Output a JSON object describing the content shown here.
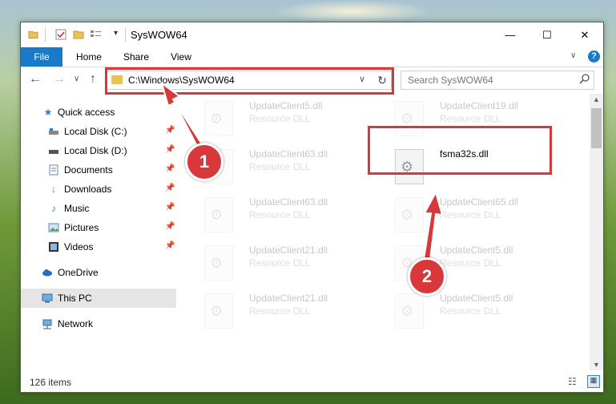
{
  "window": {
    "title": "SysWOW64",
    "controls": {
      "minimize": "—",
      "maximize": "☐",
      "close": "✕"
    }
  },
  "ribbon": {
    "tabs": [
      "File",
      "Home",
      "Share",
      "View"
    ],
    "help": "?"
  },
  "address": {
    "path": "C:\\Windows\\SysWOW64",
    "refresh": "↻",
    "search_placeholder": "Search SysWOW64"
  },
  "nav": {
    "items": [
      {
        "label": "Quick access",
        "icon": "star-icon"
      },
      {
        "label": "Local Disk (C:)",
        "icon": "drive-icon",
        "pinned": true
      },
      {
        "label": "Local Disk (D:)",
        "icon": "drive-icon",
        "pinned": true
      },
      {
        "label": "Documents",
        "icon": "documents-icon",
        "pinned": true
      },
      {
        "label": "Downloads",
        "icon": "download-icon",
        "pinned": true
      },
      {
        "label": "Music",
        "icon": "music-icon",
        "pinned": true
      },
      {
        "label": "Pictures",
        "icon": "pictures-icon",
        "pinned": true
      },
      {
        "label": "Videos",
        "icon": "videos-icon",
        "pinned": true
      },
      {
        "label": "OneDrive",
        "icon": "cloud-icon"
      },
      {
        "label": "This PC",
        "icon": "computer-icon",
        "selected": true
      },
      {
        "label": "Network",
        "icon": "network-icon"
      }
    ]
  },
  "files": [
    {
      "name": "UpdateClient5.dll",
      "type": "Resource DLL"
    },
    {
      "name": "UpdateClient19.dll",
      "type": "Resource DLL"
    },
    {
      "name": "UpdateClient63.dll",
      "type": "Resource DLL"
    },
    {
      "name": "fsma32s.dll",
      "type": ""
    },
    {
      "name": "UpdateClient63.dll",
      "type": "Resource DLL"
    },
    {
      "name": "UpdateClient65.dll",
      "type": "Resource DLL"
    },
    {
      "name": "UpdateClient21.dll",
      "type": "Resource DLL"
    },
    {
      "name": "UpdateClient5.dll",
      "type": "Resource DLL"
    },
    {
      "name": "UpdateClient21.dll",
      "type": "Resource DLL"
    },
    {
      "name": "UpdateClient5.dll",
      "type": "Resource DLL"
    }
  ],
  "status": {
    "items": "126 items"
  },
  "annotations": {
    "step1": "1",
    "step2": "2",
    "color": "#d9383a"
  }
}
